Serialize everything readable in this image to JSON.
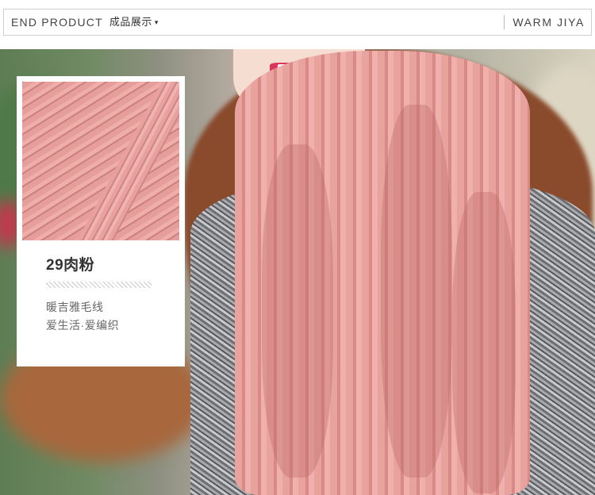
{
  "header": {
    "left_label": "END PRODUCT",
    "left_label_cn": "成品展示",
    "caret": "▾",
    "right_label": "WARM JIYA"
  },
  "card": {
    "color_name": "29肉粉",
    "line1": "暖吉雅毛线",
    "line2": "爱生活·爱编织"
  },
  "colors": {
    "scarf_pink": "#e9a39f",
    "text_dark": "#333333",
    "border_gray": "#cfcfcf"
  }
}
